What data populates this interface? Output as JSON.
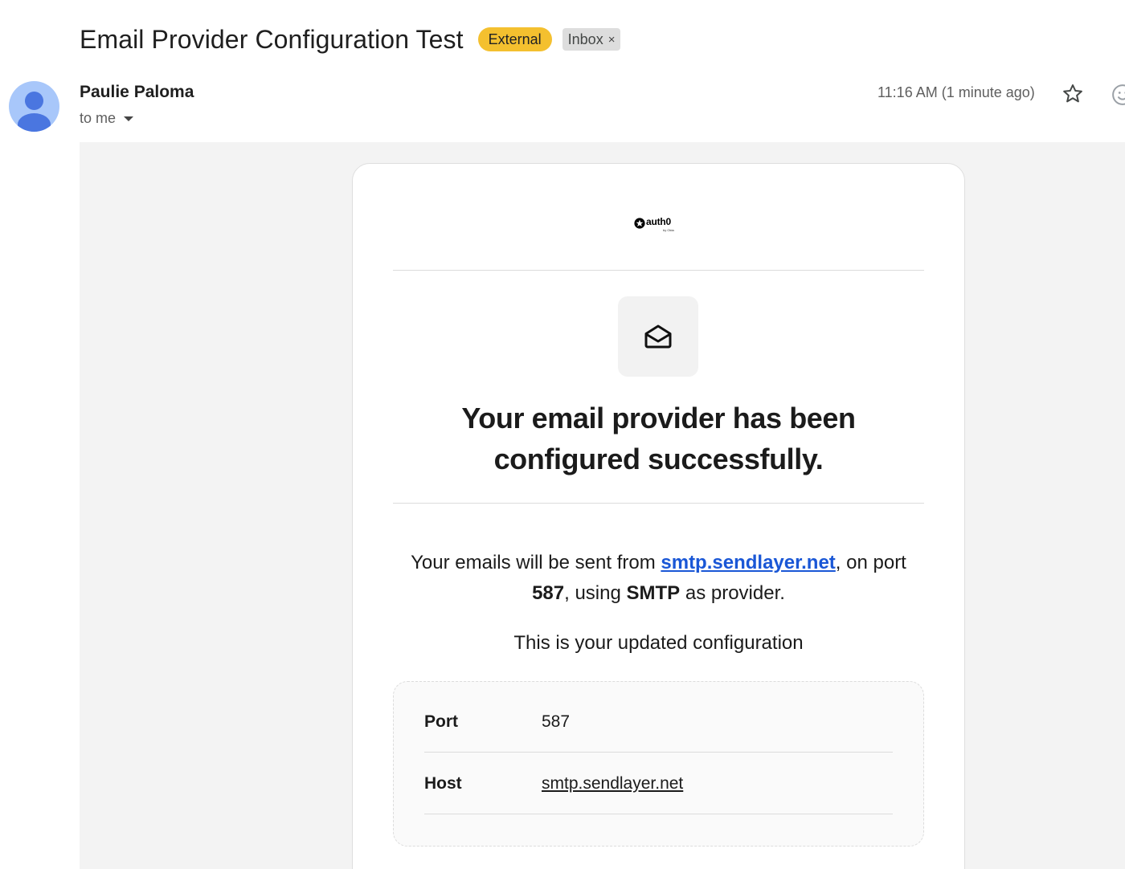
{
  "email": {
    "subject": "Email Provider Configuration Test",
    "labels": {
      "external": "External",
      "inbox": "Inbox",
      "inbox_remove": "×"
    },
    "sender": "Paulie Paloma",
    "recipient": "to me",
    "timestamp": "11:16 AM (1 minute ago)"
  },
  "message": {
    "logo": {
      "word": "auth0",
      "sub": "by Okta"
    },
    "headline_line1": "Your email provider has been",
    "headline_line2": "configured successfully.",
    "para": {
      "prefix": "Your emails will be sent from ",
      "host_link": "smtp.sendlayer.net",
      "mid1": ", on port ",
      "port": "587",
      "mid2": ", using ",
      "provider": "SMTP",
      "suffix": " as provider."
    },
    "config_intro": "This is your updated configuration",
    "config": [
      {
        "key": "Port",
        "value": "587"
      },
      {
        "key": "Host",
        "value": "smtp.sendlayer.net"
      }
    ]
  },
  "icons": {
    "avatar": "person-avatar",
    "caret": "chevron-down-icon",
    "star": "star-icon",
    "emoji": "smiley-icon",
    "envelope": "envelope-open-icon",
    "logo": "auth0-logo"
  },
  "colors": {
    "external_badge": "#f4c02f",
    "inbox_badge": "#dddddd",
    "link": "#1a57d6",
    "avatar_bg": "#a8c7fa",
    "avatar_fg": "#4a76e0",
    "body_bg": "#f3f3f3"
  }
}
